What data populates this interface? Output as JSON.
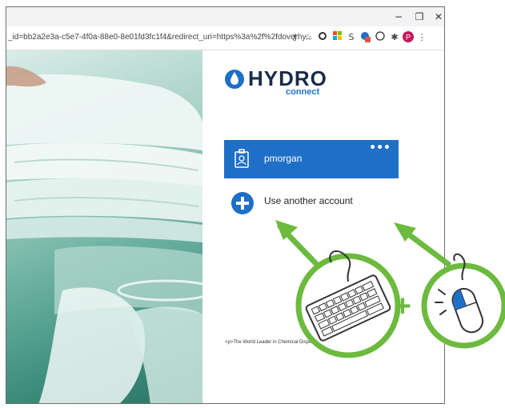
{
  "browser": {
    "window_controls": {
      "minimize": "−",
      "maximize": "❐",
      "close": "✕"
    },
    "url": "_id=bb2a2e3a-c5e7-4f0a-88e0-8e01fd3fc1f4&redirect_uri=https%3a%2f%2fdoverhy...",
    "toolbar_icons": [
      "key-icon",
      "star-icon",
      "circle-icon",
      "grid-icon",
      "s-icon",
      "extension-badge-icon",
      "chat-icon",
      "puzzle-icon",
      "profile-icon",
      "menu-icon"
    ],
    "profile_initial": "P",
    "s_label": "S"
  },
  "brand": {
    "name": "HYDRO",
    "sub": "connect"
  },
  "account": {
    "username": "pmorgan",
    "more": "•••"
  },
  "other_account": {
    "label": "Use another account"
  },
  "footer": {
    "text": "<p>The World Leader in Chemical Dispensing Equipment</p>"
  },
  "overlay": {
    "plus": "+"
  },
  "colors": {
    "accent": "#1e6fc6",
    "green": "#6cba3e",
    "brand_dark": "#1a2b4a"
  }
}
